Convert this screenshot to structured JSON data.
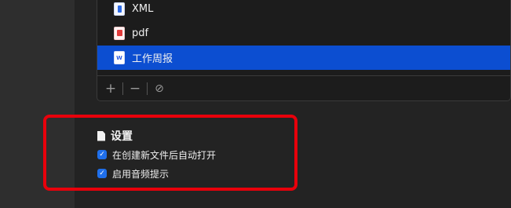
{
  "file_list": {
    "items": [
      {
        "label": "XML",
        "icon": "xml-file-icon",
        "selected": false
      },
      {
        "label": "pdf",
        "icon": "pdf-file-icon",
        "selected": false
      },
      {
        "label": "工作周报",
        "icon": "word-file-icon",
        "selected": true
      }
    ],
    "toolbar": {
      "add_glyph": "+",
      "remove_glyph": "−",
      "action_glyph": "⊘"
    }
  },
  "settings": {
    "title": "设置",
    "options": [
      {
        "label": "在创建新文件后自动打开",
        "checked": true
      },
      {
        "label": "启用音频提示",
        "checked": true
      }
    ]
  },
  "colors": {
    "selection": "#0c4ed1",
    "checkbox": "#1f6feb",
    "highlight": "#e8000b"
  },
  "glyphs": {
    "check": "✓",
    "word_badge": "W"
  }
}
